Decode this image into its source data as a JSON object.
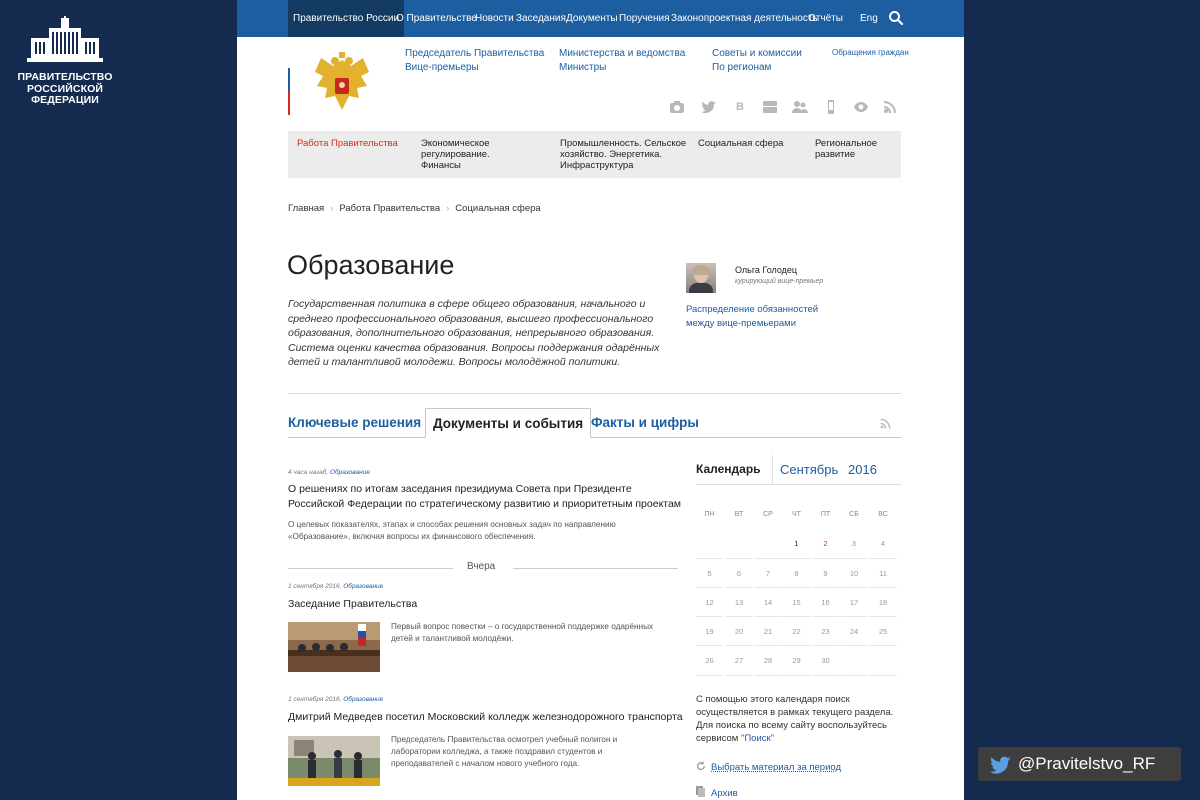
{
  "brand": {
    "line1": "ПРАВИТЕЛЬСТВО",
    "line2": "РОССИЙСКОЙ",
    "line3": "ФЕДЕРАЦИИ"
  },
  "topnav": {
    "items": [
      "Правительство России",
      "О Правительстве",
      "Новости",
      "Заседания",
      "Документы",
      "Поручения",
      "Законопроектная деятельность",
      "Отчёты"
    ],
    "lang": "Eng"
  },
  "header": {
    "links": [
      "Председатель Правительства",
      "Вице-премьеры",
      "Министерства и ведомства",
      "Министры",
      "Советы и комиссии",
      "По регионам"
    ],
    "appeals": "Обращения граждан"
  },
  "social_icons": [
    "camera-icon",
    "twitter-icon",
    "vk-icon",
    "youtube-icon",
    "community-icon",
    "mobile-icon",
    "eye-icon",
    "rss-icon"
  ],
  "secnav": {
    "items": [
      "Работа Правительства",
      "Экономическое регулирование. Финансы",
      "Промышленность. Сельское хозяйство. Энергетика. Инфраструктура",
      "Социальная сфера",
      "Региональное развитие"
    ]
  },
  "breadcrumbs": [
    "Главная",
    "Работа Правительства",
    "Социальная сфера"
  ],
  "page": {
    "title": "Образование",
    "description": "Государственная политика в сфере общего образования, начального и среднего профессионального образования, высшего профессионального образования, дополнительного образования, непрерывного образования. Система оценки качества образования. Вопросы поддержания одарённых детей и талантливой молодежи. Вопросы молодёжной политики."
  },
  "curator": {
    "name": "Ольга Голодец",
    "role": "курирующий вице-премьер",
    "link": "Распределение обязанностей между вице-премьерами"
  },
  "tabs": [
    "Ключевые решения",
    "Документы и события",
    "Факты и цифры"
  ],
  "feed": {
    "items": [
      {
        "time": "4 часа назад,",
        "tag": "Образование",
        "title": "О решениях по итогам заседания президиума Совета при Президенте Российской Федерации по стратегическому развитию и приоритетным проектам",
        "summary": "О целевых показателях, этапах и способах решения основных задач по направлению «Образование», включая вопросы их финансового обеспечения."
      },
      {
        "time": "1 сентября 2016,",
        "tag": "Образование",
        "title": "Заседание Правительства",
        "summary": "Первый вопрос повестки – о государственной поддержке одарённых детей и талантливой молодёжи."
      },
      {
        "time": "1 сентября 2016,",
        "tag": "Образование",
        "title": "Дмитрий Медведев посетил Московский колледж железнодорожного транспорта",
        "summary": "Председатель Правительства осмотрел учебный полигон и лаборатории колледжа, а также поздравил студентов и преподавателей с началом нового учебного года."
      }
    ],
    "divider": "Вчера"
  },
  "calendar": {
    "title": "Календарь",
    "month": "Сентябрь",
    "year": "2016",
    "weekdays": [
      "ПН",
      "ВТ",
      "СР",
      "ЧТ",
      "ПТ",
      "СБ",
      "ВС"
    ],
    "weeks": [
      [
        "",
        "",
        "",
        "1",
        "2",
        "3",
        "4"
      ],
      [
        "5",
        "6",
        "7",
        "8",
        "9",
        "10",
        "11"
      ],
      [
        "12",
        "13",
        "14",
        "15",
        "16",
        "17",
        "18"
      ],
      [
        "19",
        "20",
        "21",
        "22",
        "23",
        "24",
        "25"
      ],
      [
        "26",
        "27",
        "28",
        "29",
        "30",
        "",
        ""
      ]
    ],
    "active_days": [
      "1"
    ],
    "highlight_days": [
      "2"
    ],
    "note": "С помощью этого календаря поиск осуществляется в рамках текущего раздела. Для поиска по всему сайту воспользуйтесь сервисом",
    "note_link": "\"Поиск\"",
    "period_link": "Выбрать материал за период",
    "archive_link": "Архив"
  },
  "twitter_badge": "@Pravitelstvo_RF",
  "colors": {
    "navy_bg": "#152a4f",
    "nav_blue": "#1d5ea0",
    "link_blue": "#1d5ea0",
    "accent_red": "#d52b1e"
  }
}
